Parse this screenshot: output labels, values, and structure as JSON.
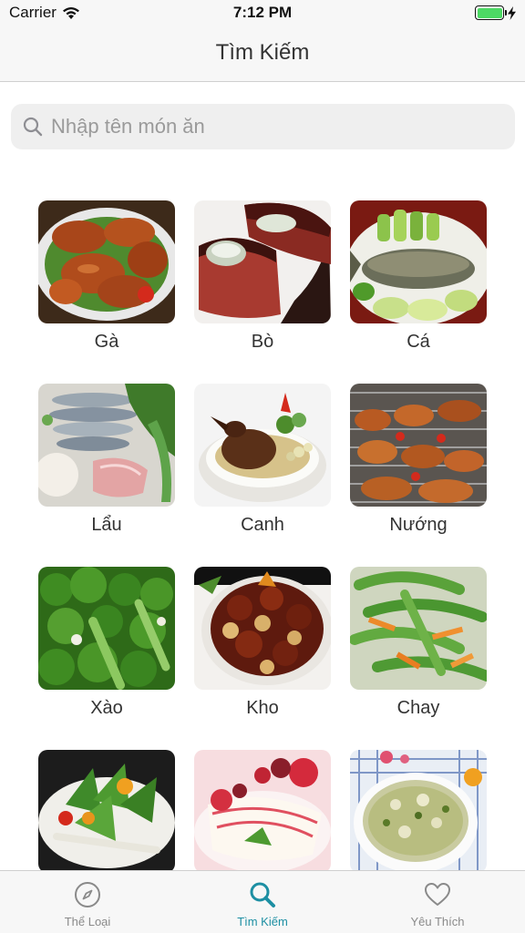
{
  "status": {
    "carrier": "Carrier",
    "time": "7:12 PM"
  },
  "nav": {
    "title": "Tìm Kiếm"
  },
  "search": {
    "placeholder": "Nhập tên món ăn"
  },
  "categories": [
    {
      "label": "Gà",
      "icon": "chicken-image"
    },
    {
      "label": "Bò",
      "icon": "beef-image"
    },
    {
      "label": "Cá",
      "icon": "fish-image"
    },
    {
      "label": "Lẩu",
      "icon": "hotpot-image"
    },
    {
      "label": "Canh",
      "icon": "soup-image"
    },
    {
      "label": "Nướng",
      "icon": "grill-image"
    },
    {
      "label": "Xào",
      "icon": "stirfry-image"
    },
    {
      "label": "Kho",
      "icon": "braised-image"
    },
    {
      "label": "Chay",
      "icon": "vegetarian-image"
    },
    {
      "label": "",
      "icon": "salad-image"
    },
    {
      "label": "",
      "icon": "dessert-image"
    },
    {
      "label": "",
      "icon": "porridge-image"
    }
  ],
  "tabs": [
    {
      "label": "Thể Loại",
      "icon": "compass-icon",
      "active": false
    },
    {
      "label": "Tìm Kiếm",
      "icon": "search-icon",
      "active": true
    },
    {
      "label": "Yêu Thích",
      "icon": "heart-icon",
      "active": false
    }
  ],
  "colors": {
    "accent": "#1d8fa3",
    "inactive": "#8a8a8a",
    "battery": "#4cd964"
  }
}
